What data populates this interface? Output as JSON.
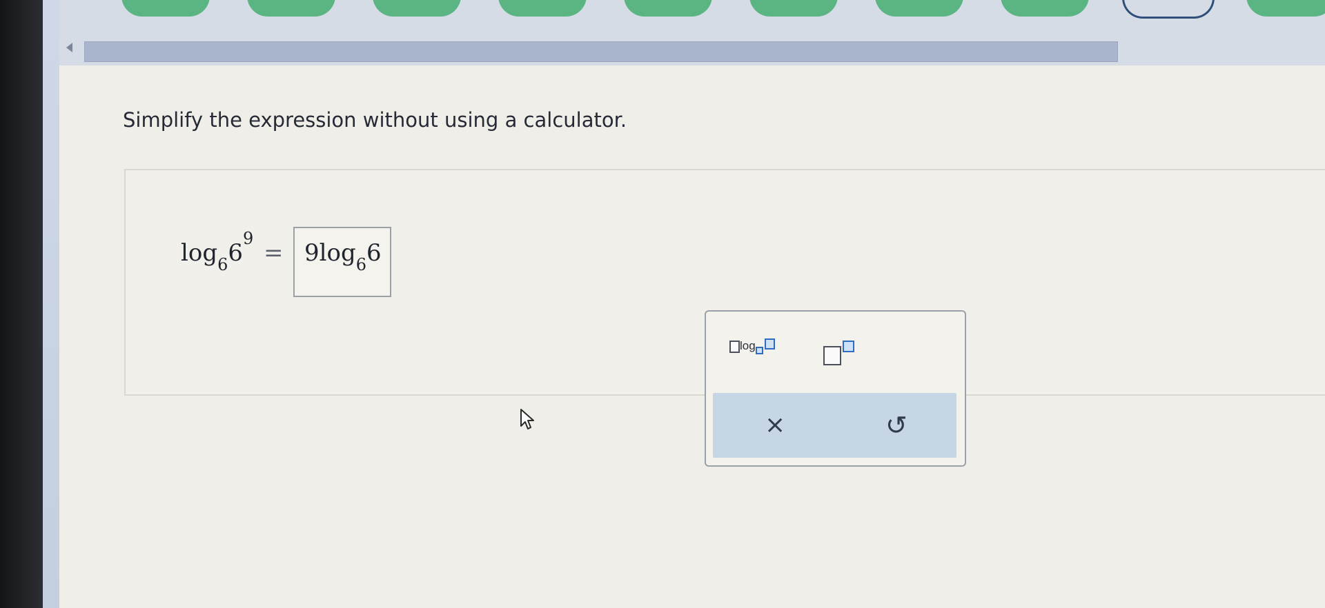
{
  "instruction": "Simplify the expression without using a calculator.",
  "expression": {
    "func": "log",
    "base": "6",
    "arg": "6",
    "exponent": "9",
    "equals": "="
  },
  "answer": {
    "coefficient": "9",
    "func": "log",
    "base": "6",
    "arg": "6"
  },
  "palette": {
    "log_tool_label": "log",
    "clear_icon": "×",
    "undo_icon": "↺"
  },
  "colors": {
    "nav_pill_green": "#5bb583",
    "progress_bar": "#a9b4cd",
    "action_bar": "#c7d6e5",
    "accent_blue": "#2f6bc0"
  }
}
